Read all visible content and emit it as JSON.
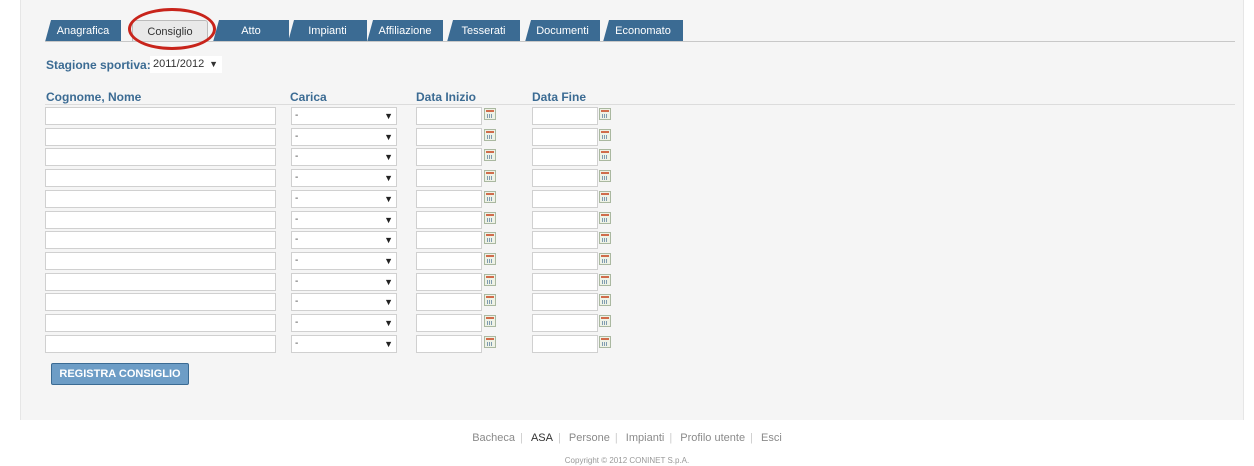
{
  "tabs": [
    {
      "label": "Anagrafica",
      "active": false
    },
    {
      "label": "Consiglio",
      "active": true
    },
    {
      "label": "Atto",
      "active": false
    },
    {
      "label": "Impianti",
      "active": false
    },
    {
      "label": "Affiliazione",
      "active": false
    },
    {
      "label": "Tesserati",
      "active": false
    },
    {
      "label": "Documenti",
      "active": false
    },
    {
      "label": "Economato",
      "active": false
    }
  ],
  "season": {
    "label": "Stagione sportiva:",
    "value": "2011/2012"
  },
  "columns": {
    "name": "Cognome, Nome",
    "role": "Carica",
    "start": "Data Inizio",
    "end": "Data Fine"
  },
  "role_default": "-",
  "row_count": 12,
  "register_button": "REGISTRA CONSIGLIO",
  "footer": {
    "links": [
      "Bacheca",
      "ASA",
      "Persone",
      "Impianti",
      "Profilo utente",
      "Esci"
    ],
    "current": "ASA",
    "copyright": "Copyright © 2012 CONINET S.p.A."
  },
  "colors": {
    "accent": "#3b6b93",
    "highlight": "#c8241b"
  }
}
